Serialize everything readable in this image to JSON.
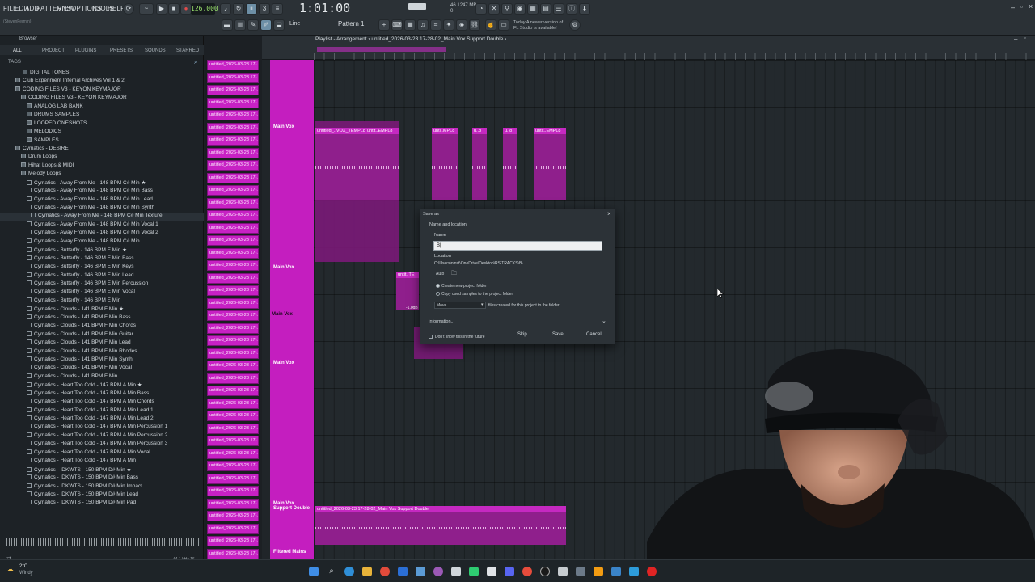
{
  "menu": [
    "FILE",
    "EDIT",
    "ADD",
    "PATTERNS",
    "VIEW",
    "OPTIONS",
    "TOOLS",
    "HELP"
  ],
  "user_hint": "(StevenFermin)",
  "transport": {
    "tempo": "126.000",
    "time": "1:01:00",
    "pattern": "Pattern 1",
    "cpu_a": "46",
    "cpu_b": "1247 MB",
    "cpu_c": "0"
  },
  "update_notice": {
    "line1": "Today  A newer version of",
    "line2": "FL Studio is available!"
  },
  "browser": {
    "title": "Browser",
    "tabs": [
      "ALL",
      "PROJECT",
      "PLUGINS",
      "PRESETS",
      "SOUNDS",
      "STARRED"
    ],
    "tags_label": "TAGS",
    "items": [
      "DIGITAL TONES",
      "Club Experiment Infernal Archives Vol 1 & 2",
      "CODING FILES V3 - KEYON KEYMAJOR",
      "CODING FILES V3 - KEYON KEYMAJOR",
      "ANALOG LAB BANK",
      "DRUMS SAMPLES",
      "LOOPED ONESHOTS",
      "MELODICS",
      "SAMPLES",
      "Cymatics - DESIRE",
      "Drum Loops",
      "Hihat Loops & MIDI",
      "Melody Loops",
      "Cymatics - Away From Me - 148 BPM C# Min ★",
      "Cymatics - Away From Me - 148 BPM C# Min Bass",
      "Cymatics - Away From Me - 148 BPM C# Min Lead",
      "Cymatics - Away From Me - 148 BPM C# Min Synth",
      "Cymatics - Away From Me - 148 BPM C# Min Texture",
      "Cymatics - Away From Me - 148 BPM C# Min Vocal 1",
      "Cymatics - Away From Me - 148 BPM C# Min Vocal 2",
      "Cymatics - Away From Me - 148 BPM C# Min",
      "Cymatics - Butterfly - 146 BPM E Min ★",
      "Cymatics - Butterfly - 146 BPM E Min Bass",
      "Cymatics - Butterfly - 146 BPM E Min Keys",
      "Cymatics - Butterfly - 146 BPM E Min Lead",
      "Cymatics - Butterfly - 146 BPM E Min Percussion",
      "Cymatics - Butterfly - 146 BPM E Min Vocal",
      "Cymatics - Butterfly - 146 BPM E Min",
      "Cymatics - Clouds - 141 BPM F Min ★",
      "Cymatics - Clouds - 141 BPM F Min Bass",
      "Cymatics - Clouds - 141 BPM F Min Chords",
      "Cymatics - Clouds - 141 BPM F Min Guitar",
      "Cymatics - Clouds - 141 BPM F Min Lead",
      "Cymatics - Clouds - 141 BPM F Min Rhodes",
      "Cymatics - Clouds - 141 BPM F Min Synth",
      "Cymatics - Clouds - 141 BPM F Min Vocal",
      "Cymatics - Clouds - 141 BPM F Min",
      "Cymatics - Heart Too Cold - 147 BPM A Min ★",
      "Cymatics - Heart Too Cold - 147 BPM A Min Bass",
      "Cymatics - Heart Too Cold - 147 BPM A Min Chords",
      "Cymatics - Heart Too Cold - 147 BPM A Min Lead 1",
      "Cymatics - Heart Too Cold - 147 BPM A Min Lead 2",
      "Cymatics - Heart Too Cold - 147 BPM A Min Percussion 1",
      "Cymatics - Heart Too Cold - 147 BPM A Min Percussion 2",
      "Cymatics - Heart Too Cold - 147 BPM A Min Percussion 3",
      "Cymatics - Heart Too Cold - 147 BPM A Min Vocal",
      "Cymatics - Heart Too Cold - 147 BPM A Min",
      "Cymatics - IDKWTS - 150 BPM D# Min ★",
      "Cymatics - IDKWTS - 150 BPM D# Min Bass",
      "Cymatics - IDKWTS - 150 BPM D# Min Impact",
      "Cymatics - IDKWTS - 150 BPM D# Min Lead",
      "Cymatics - IDKWTS - 150 BPM D# Min Pad"
    ],
    "footer": "44.1 kHz 16"
  },
  "clip_label": "untitled_2026-03-23 17-...",
  "playlist": {
    "title": "Playlist - Arrangement  ›  untitled_2026-03-23 17-28-02_Main Vox Support Double  ›",
    "tracks": [
      "Main Vox",
      "Main Vox",
      "Main Vox",
      "Main Vox",
      "Main Vox Support Double",
      "Filtered Mains"
    ],
    "clips": [
      "untitled_..VOX_TEMPL8",
      "untit..EMPL8",
      "unti..MPL8",
      "u..8",
      "u..8",
      "untit..EMPL8",
      "untit..TE",
      "untitled_2026-03-23 17-28-02_Main Vox Support Double"
    ],
    "volume_badge": "-1.0dB"
  },
  "dialog": {
    "title": "Save as",
    "section": "Name and location",
    "name_label": "Name",
    "name_value": "B|",
    "location_label": "Location",
    "location_value": "C:\\Users\\ninst\\OneDrive\\Desktop\\RS TRACKS\\B\\",
    "auto_label": "Auto",
    "create_folder": "Create new project folder",
    "copy_samples": "Copy used samples to the project folder",
    "move_label": "Move",
    "files_created": "files created for this project to the folder",
    "information": "Information...",
    "dont_show": "Don't show this in the future",
    "skip": "Skip",
    "save": "Save",
    "cancel": "Cancel"
  },
  "taskbar": {
    "weather_temp": "2°C",
    "weather_desc": "Windy"
  }
}
